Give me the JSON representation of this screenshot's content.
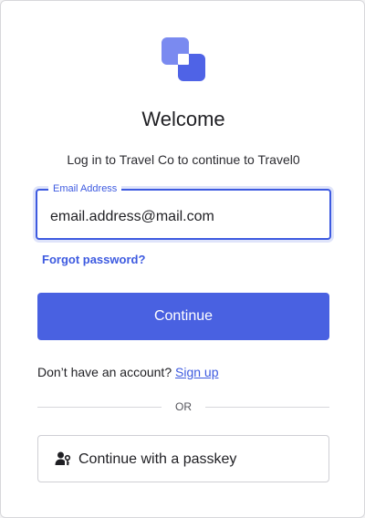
{
  "header": {
    "title": "Welcome",
    "subtitle": "Log in to Travel Co to continue to Travel0"
  },
  "email": {
    "label": "Email Address",
    "value": "email.address@mail.com"
  },
  "links": {
    "forgot_password": "Forgot password?"
  },
  "actions": {
    "continue_label": "Continue",
    "passkey_label": "Continue with a passkey"
  },
  "signup": {
    "prompt": "Don’t have an account?",
    "link": "Sign up"
  },
  "divider": {
    "text": "OR"
  },
  "colors": {
    "accent": "#4961e1",
    "logo_light": "#7a8af0",
    "logo_dark": "#4f63e6"
  },
  "icons": {
    "logo": "travel-co-logo",
    "passkey": "person-key-icon"
  }
}
